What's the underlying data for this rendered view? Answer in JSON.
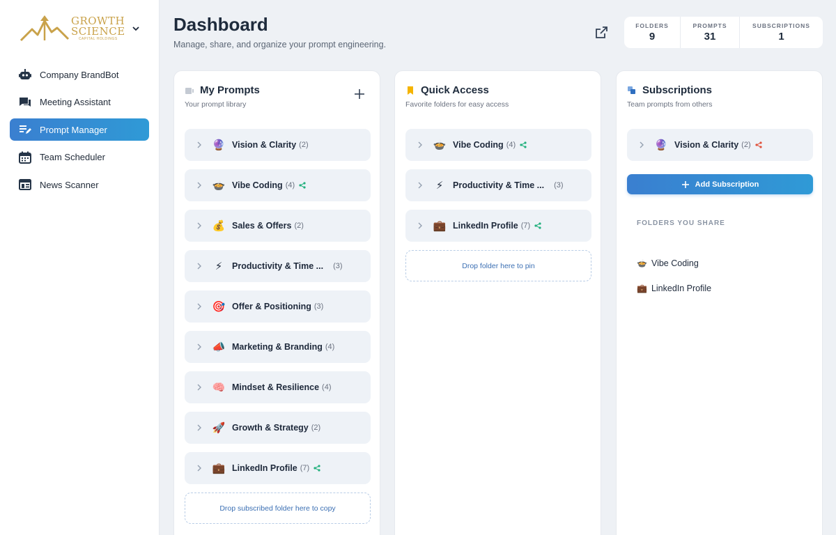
{
  "brand": {
    "line1": "GROWTH",
    "line2": "SCIENCE",
    "line3": "CAPITAL HOLDINGS",
    "color": "#c9a24a"
  },
  "nav": [
    {
      "label": "Company BrandBot",
      "icon": "robot-icon"
    },
    {
      "label": "Meeting Assistant",
      "icon": "chat-icon"
    },
    {
      "label": "Prompt Manager",
      "icon": "edit-list-icon",
      "active": true
    },
    {
      "label": "Team Scheduler",
      "icon": "calendar-icon"
    },
    {
      "label": "News Scanner",
      "icon": "newspaper-icon"
    }
  ],
  "header": {
    "title": "Dashboard",
    "subtitle": "Manage, share, and organize your prompt engineering."
  },
  "stats": [
    {
      "label": "FOLDERS",
      "value": "9"
    },
    {
      "label": "PROMPTS",
      "value": "31"
    },
    {
      "label": "SUBSCRIPTIONS",
      "value": "1"
    }
  ],
  "my_prompts": {
    "title": "My Prompts",
    "subtitle": "Your prompt library",
    "folders": [
      {
        "emoji": "🔮",
        "name": "Vision & Clarity",
        "count": "(2)",
        "shared": false
      },
      {
        "emoji": "🍲",
        "name": "Vibe Coding",
        "count": "(4)",
        "shared": true
      },
      {
        "emoji": "💰",
        "name": "Sales & Offers",
        "count": "(2)",
        "shared": false
      },
      {
        "emoji": "⚡",
        "name": "Productivity & Time ...",
        "count": "(3)",
        "shared": false
      },
      {
        "emoji": "🎯",
        "name": "Offer & Positioning",
        "count": "(3)",
        "shared": false
      },
      {
        "emoji": "📣",
        "name": "Marketing & Branding",
        "count": "(4)",
        "shared": false
      },
      {
        "emoji": "🧠",
        "name": "Mindset & Resilience",
        "count": "(4)",
        "shared": false
      },
      {
        "emoji": "🚀",
        "name": "Growth & Strategy",
        "count": "(2)",
        "shared": false
      },
      {
        "emoji": "💼",
        "name": "LinkedIn Profile",
        "count": "(7)",
        "shared": true
      }
    ],
    "dropzone": "Drop subscribed folder here to copy"
  },
  "quick_access": {
    "title": "Quick Access",
    "subtitle": "Favorite folders for easy access",
    "folders": [
      {
        "emoji": "🍲",
        "name": "Vibe Coding",
        "count": "(4)",
        "shared": true
      },
      {
        "emoji": "⚡",
        "name": "Productivity & Time ...",
        "count": "(3)",
        "shared": false
      },
      {
        "emoji": "💼",
        "name": "LinkedIn Profile",
        "count": "(7)",
        "shared": true
      }
    ],
    "dropzone": "Drop folder here to pin"
  },
  "subscriptions": {
    "title": "Subscriptions",
    "subtitle": "Team prompts from others",
    "folders": [
      {
        "emoji": "🔮",
        "name": "Vision & Clarity",
        "count": "(2)",
        "shared": true,
        "share_color": "#e0533d"
      }
    ],
    "add_label": "Add Subscription",
    "share_heading": "FOLDERS YOU SHARE",
    "shared": [
      {
        "emoji": "🍲",
        "name": "Vibe Coding"
      },
      {
        "emoji": "💼",
        "name": "LinkedIn Profile"
      }
    ]
  },
  "colors": {
    "accent": "#3a7fd0",
    "share_green": "#22b07d",
    "share_red": "#e0533d"
  }
}
